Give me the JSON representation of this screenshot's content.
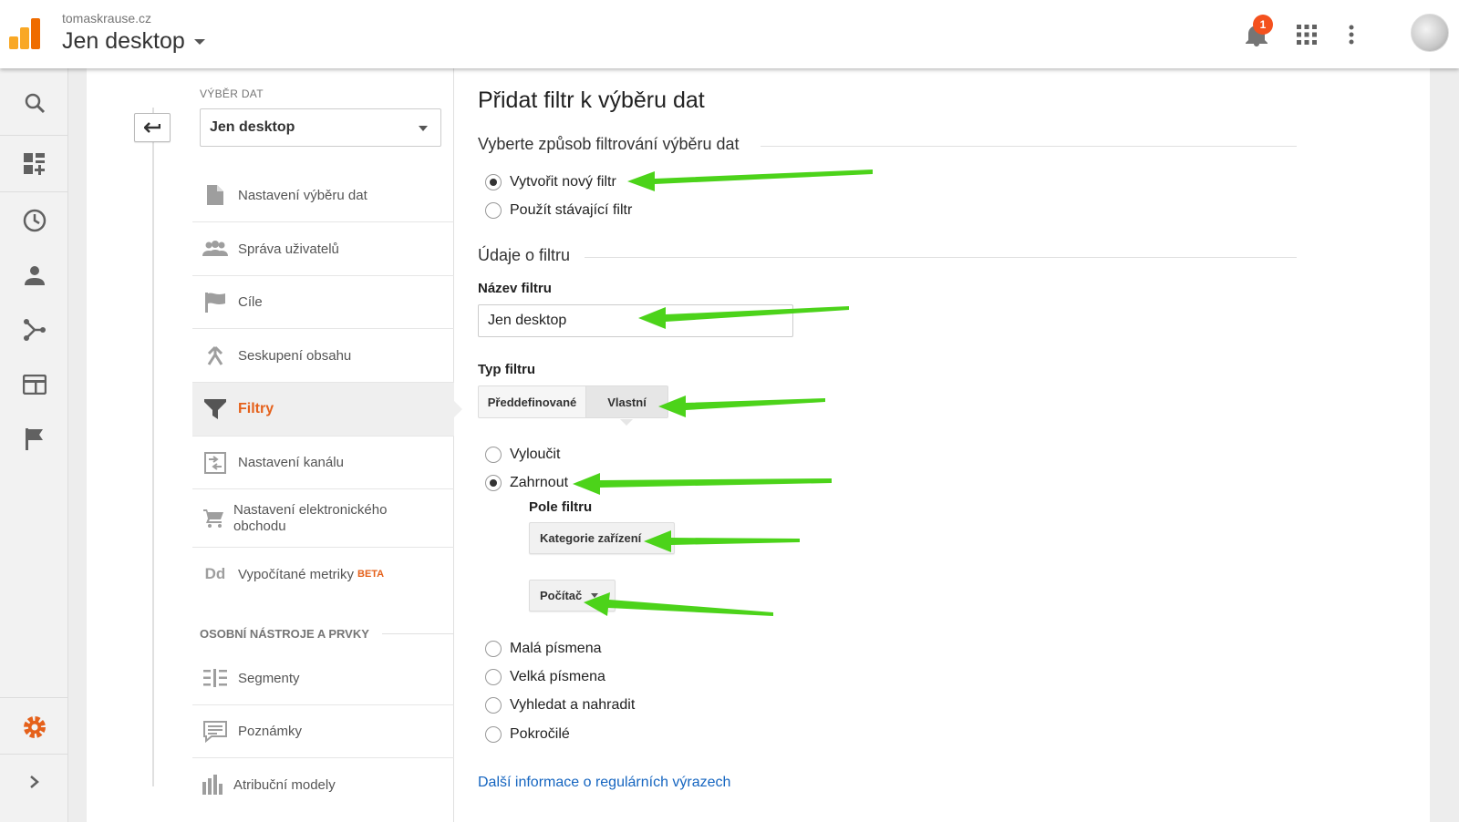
{
  "header": {
    "site": "tomaskrause.cz",
    "view": "Jen desktop",
    "notifications_count": "1"
  },
  "rail": {
    "icons": [
      "search-icon",
      "customization-icon",
      "realtime-icon",
      "audience-icon",
      "acquisition-icon",
      "behavior-icon",
      "conversions-icon",
      "admin-gear-icon",
      "expand-icon"
    ]
  },
  "nav": {
    "section_label": "VÝBĚR DAT",
    "selected_view": "Jen desktop",
    "items": [
      {
        "label": "Nastavení výběru dat",
        "icon": "document-icon"
      },
      {
        "label": "Správa uživatelů",
        "icon": "users-icon"
      },
      {
        "label": "Cíle",
        "icon": "flag-icon"
      },
      {
        "label": "Seskupení obsahu",
        "icon": "content-grouping-icon"
      },
      {
        "label": "Filtry",
        "icon": "filter-icon"
      },
      {
        "label": "Nastavení kanálu",
        "icon": "channel-settings-icon"
      },
      {
        "label": "Nastavení elektronického obchodu",
        "icon": "cart-icon"
      },
      {
        "label": "Vypočítané metriky",
        "badge": "BETA",
        "icon": "calculated-metrics-icon"
      }
    ],
    "personal_heading": "OSOBNÍ NÁSTROJE A PRVKY",
    "personal_items": [
      {
        "label": "Segmenty",
        "icon": "segments-icon"
      },
      {
        "label": "Poznámky",
        "icon": "annotations-icon"
      },
      {
        "label": "Atribuční modely",
        "icon": "attribution-icon"
      }
    ]
  },
  "form": {
    "title": "Přidat filtr k výběru dat",
    "method_heading": "Vyberte způsob filtrování výběru dat",
    "method_options": [
      "Vytvořit nový filtr",
      "Použít stávající filtr"
    ],
    "method_selected": 0,
    "info_heading": "Údaje o filtru",
    "name_label": "Název filtru",
    "name_value": "Jen desktop",
    "type_label": "Typ filtru",
    "type_options": [
      "Předdefinované",
      "Vlastní"
    ],
    "type_selected": "Vlastní",
    "custom_options": [
      "Vyloučit",
      "Zahrnout",
      "Malá písmena",
      "Velká písmena",
      "Vyhledat a nahradit",
      "Pokročilé"
    ],
    "custom_selected": "Zahrnout",
    "field_label": "Pole filtru",
    "field_value": "Kategorie zařízení",
    "pattern_value": "Počítač",
    "regex_link": "Další informace o regulárních výrazech"
  },
  "colors": {
    "accent_orange": "#e5611b",
    "link_blue": "#1565c0",
    "arrow_green": "#4cd31a"
  }
}
